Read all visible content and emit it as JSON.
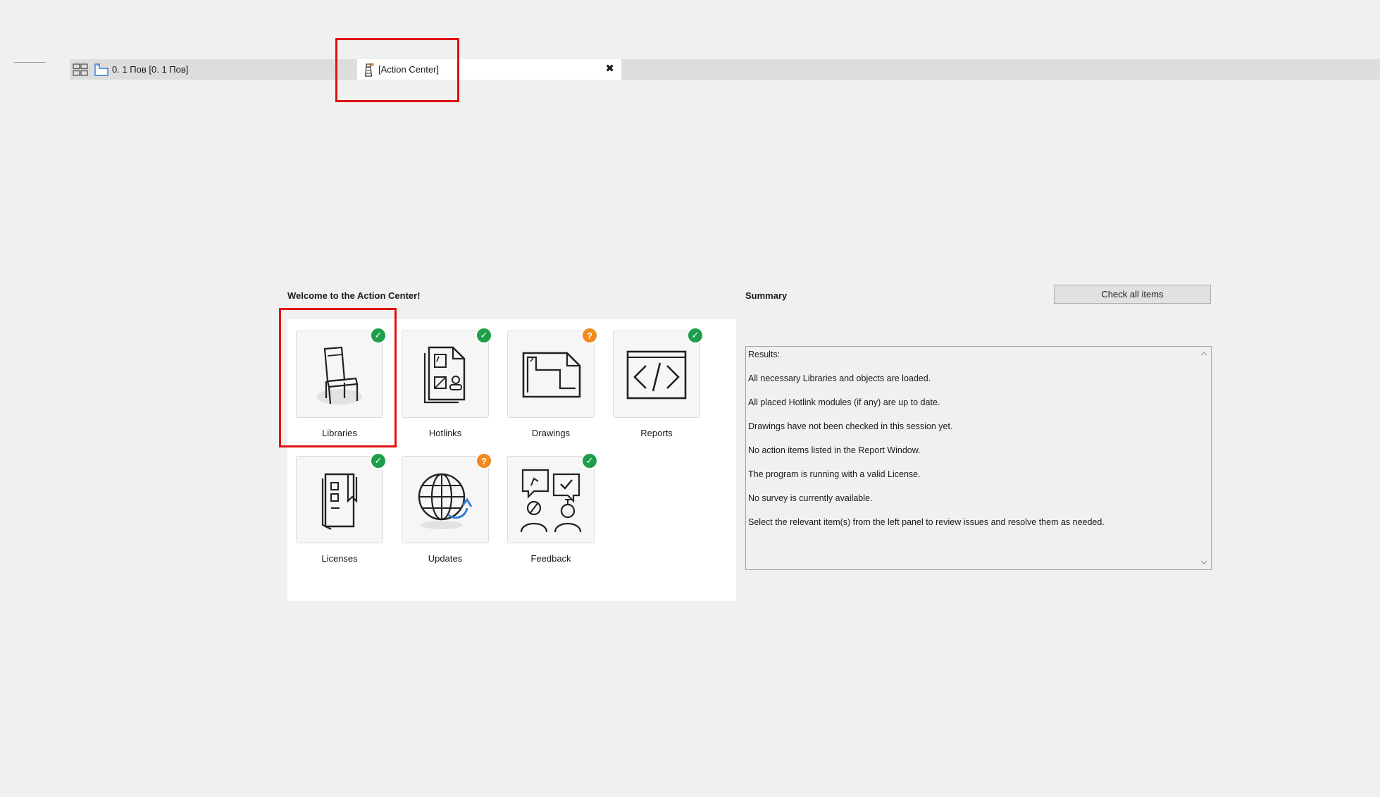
{
  "tabs": {
    "plan_label": "0. 1 Пов [0. 1 Пов]",
    "active_label": "[Action Center]",
    "close_glyph": "✖"
  },
  "header": {
    "welcome": "Welcome to the Action Center!",
    "summary": "Summary",
    "check_all": "Check all items"
  },
  "tiles": [
    {
      "label": "Libraries",
      "status": "ok",
      "icon": "chair-icon"
    },
    {
      "label": "Hotlinks",
      "status": "ok",
      "icon": "hotlink-file-icon"
    },
    {
      "label": "Drawings",
      "status": "warn",
      "icon": "drawing-file-icon"
    },
    {
      "label": "Reports",
      "status": "ok",
      "icon": "code-window-icon"
    },
    {
      "label": "Licenses",
      "status": "ok",
      "icon": "license-book-icon"
    },
    {
      "label": "Updates",
      "status": "warn",
      "icon": "globe-update-icon"
    },
    {
      "label": "Feedback",
      "status": "ok",
      "icon": "feedback-people-icon"
    }
  ],
  "badges": {
    "ok": "✓",
    "warn": "?"
  },
  "results": [
    "Results:",
    "All necessary Libraries and objects are loaded.",
    "All placed Hotlink modules (if any) are up to date.",
    "Drawings have not been checked in this session yet.",
    "No action items listed in the Report Window.",
    "The program is running with a valid License.",
    "No survey is currently available.",
    "Select the relevant item(s) from the left panel to review issues and resolve them as needed."
  ],
  "colors": {
    "ok": "#1e9e4a",
    "warn": "#f08a1e",
    "highlight": "#e01010",
    "accent_blue": "#2f7fd6"
  }
}
